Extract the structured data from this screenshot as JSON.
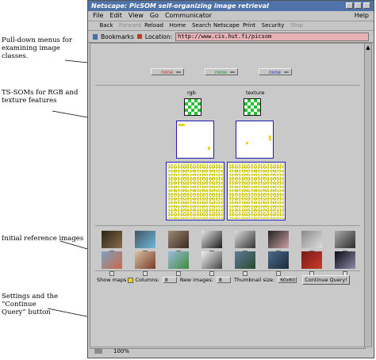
{
  "annotations": {
    "menus": "Pull-down menus for examining image classes.",
    "tssoms": "TS-SOMs for RGB and texture features",
    "reference": "Initial reference images",
    "settings": "Settings and the “Continue Query” button"
  },
  "window": {
    "title": "Netscape: PicSOM self-organizing image retrieval",
    "menu": [
      "File",
      "Edit",
      "View",
      "Go",
      "Communicator",
      "Help"
    ],
    "nav": [
      {
        "label": "Back",
        "enabled": true
      },
      {
        "label": "Forward",
        "enabled": false
      },
      {
        "label": "Reload",
        "enabled": true
      },
      {
        "label": "Home",
        "enabled": true
      },
      {
        "label": "Search",
        "enabled": true
      },
      {
        "label": "Netscape",
        "enabled": true
      },
      {
        "label": "Print",
        "enabled": true
      },
      {
        "label": "Security",
        "enabled": true
      },
      {
        "label": "Stop",
        "enabled": false
      }
    ],
    "bookmarks_label": "Bookmarks",
    "location_label": "Location:",
    "location_value": "http://www.cis.hut.fi/picsom",
    "status_zoom": "100%"
  },
  "class_menus": [
    {
      "value": "none",
      "color": "#c42828"
    },
    {
      "value": "none",
      "color": "#1f8f2a"
    },
    {
      "value": "none",
      "color": "#2a2ac4"
    }
  ],
  "soms": [
    {
      "label": "rgb"
    },
    {
      "label": "texture"
    }
  ],
  "reference_images": {
    "row1": [
      {
        "name": "person-photo",
        "colors": [
          "#2a2418",
          "#8a6c4a"
        ]
      },
      {
        "name": "shoe-photo",
        "colors": [
          "#445565",
          "#6fb7d8"
        ]
      },
      {
        "name": "statue-photo",
        "colors": [
          "#9c8a76",
          "#3a2a20"
        ]
      },
      {
        "name": "dark-figure-photo",
        "colors": [
          "#e6e6e6",
          "#1a1a1a"
        ]
      },
      {
        "name": "bw-collage-photo",
        "colors": [
          "#dcdcdc",
          "#333333"
        ]
      },
      {
        "name": "woman-photo",
        "colors": [
          "#222222",
          "#c9a0a0"
        ]
      },
      {
        "name": "aircraft-photo",
        "colors": [
          "#8a8a8a",
          "#dedede"
        ]
      },
      {
        "name": "car-photo",
        "colors": [
          "#aaaaaa",
          "#2c2c2c"
        ]
      }
    ],
    "row2": [
      {
        "name": "building-photo",
        "colors": [
          "#7f9fbf",
          "#c96a4a"
        ]
      },
      {
        "name": "people-photo",
        "colors": [
          "#d6c2a2",
          "#7a3a2a"
        ]
      },
      {
        "name": "white-house-photo",
        "colors": [
          "#9bbbe0",
          "#3f8a3a"
        ]
      },
      {
        "name": "bw-portrait-photo",
        "colors": [
          "#f2f2f2",
          "#444444"
        ]
      },
      {
        "name": "landscape-photo",
        "colors": [
          "#5c7a9a",
          "#2c4a2c"
        ]
      },
      {
        "name": "city-photo",
        "colors": [
          "#4a6a8a",
          "#1a2a3a"
        ]
      },
      {
        "name": "red-pattern-photo",
        "colors": [
          "#7a1a1a",
          "#c83a2a"
        ]
      },
      {
        "name": "fireworks-photo",
        "colors": [
          "#0a0a14",
          "#8a8aaa"
        ]
      }
    ]
  },
  "settings": {
    "show_maps_label": "Show maps",
    "columns_label": "Columns:",
    "columns_value": "8",
    "new_images_label": "New images:",
    "new_images_value": "8",
    "thumbnail_label": "Thumbnail size:",
    "thumbnail_value": "60x60",
    "continue_label": "Continue Query!"
  }
}
